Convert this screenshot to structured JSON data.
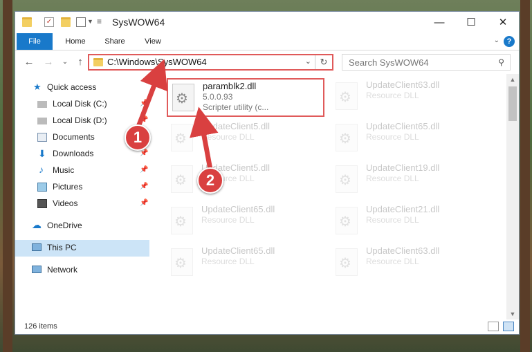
{
  "window": {
    "title": "SysWOW64",
    "controls": {
      "minimize": "—",
      "maximize": "☐",
      "close": "✕"
    }
  },
  "ribbon": {
    "tabs": [
      "File",
      "Home",
      "Share",
      "View"
    ],
    "help": "?"
  },
  "address": {
    "path": "C:\\Windows\\SysWOW64",
    "search_placeholder": "Search SysWOW64"
  },
  "nav": {
    "items": [
      {
        "label": "Quick access",
        "icon": "star-icon",
        "pinned": false
      },
      {
        "label": "Local Disk (C:)",
        "icon": "drive-icon",
        "pinned": true
      },
      {
        "label": "Local Disk (D:)",
        "icon": "drive-icon",
        "pinned": true
      },
      {
        "label": "Documents",
        "icon": "documents-icon",
        "pinned": true
      },
      {
        "label": "Downloads",
        "icon": "download-icon",
        "pinned": true
      },
      {
        "label": "Music",
        "icon": "music-icon",
        "pinned": true
      },
      {
        "label": "Pictures",
        "icon": "pictures-icon",
        "pinned": true
      },
      {
        "label": "Videos",
        "icon": "videos-icon",
        "pinned": true
      },
      {
        "label": "OneDrive",
        "icon": "cloud-icon",
        "pinned": false
      },
      {
        "label": "This PC",
        "icon": "computer-icon",
        "pinned": false,
        "selected": true
      },
      {
        "label": "Network",
        "icon": "network-icon",
        "pinned": false
      }
    ]
  },
  "files": {
    "highlighted": {
      "name": "paramblk2.dll",
      "version": "5.0.0.93",
      "description": "Scripter utility (c..."
    },
    "faded": [
      {
        "name": "UpdateClient63.dll",
        "type": "Resource DLL"
      },
      {
        "name": "UpdateClient5.dll",
        "type": "Resource DLL"
      },
      {
        "name": "UpdateClient65.dll",
        "type": "Resource DLL"
      },
      {
        "name": "UpdateClient5.dll",
        "type": "Resource DLL"
      },
      {
        "name": "UpdateClient19.dll",
        "type": "Resource DLL"
      },
      {
        "name": "UpdateClient65.dll",
        "type": "Resource DLL"
      },
      {
        "name": "UpdateClient21.dll",
        "type": "Resource DLL"
      },
      {
        "name": "UpdateClient65.dll",
        "type": "Resource DLL"
      },
      {
        "name": "UpdateClient63.dll",
        "type": "Resource DLL"
      }
    ]
  },
  "status": {
    "count": "126 items"
  },
  "callouts": [
    "1",
    "2"
  ],
  "colors": {
    "accent": "#1979ca",
    "highlight": "#e05a5a",
    "callout": "#d94040"
  }
}
